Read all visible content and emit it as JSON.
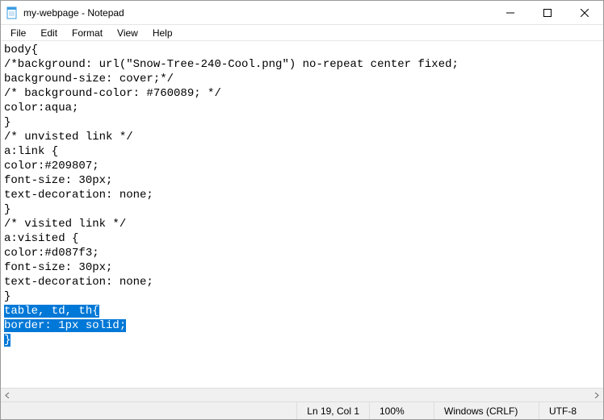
{
  "titlebar": {
    "title": "my-webpage - Notepad"
  },
  "menubar": {
    "file": "File",
    "edit": "Edit",
    "format": "Format",
    "view": "View",
    "help": "Help"
  },
  "editor": {
    "lines": [
      "body{",
      "/*background: url(\"Snow-Tree-240-Cool.png\") no-repeat center fixed;",
      "background-size: cover;*/",
      "/* background-color: #760089; */",
      "color:aqua;",
      "}",
      "/* unvisted link */",
      "a:link {",
      "color:#209807;",
      "font-size: 30px;",
      "text-decoration: none;",
      "}",
      "/* visited link */",
      "a:visited {",
      "color:#d087f3;",
      "font-size: 30px;",
      "text-decoration: none;",
      "}"
    ],
    "selected_lines": [
      "table, td, th{",
      "border: 1px solid;",
      "}"
    ]
  },
  "statusbar": {
    "cursor": "Ln 19, Col 1",
    "zoom": "100%",
    "lineending": "Windows (CRLF)",
    "encoding": "UTF-8"
  }
}
